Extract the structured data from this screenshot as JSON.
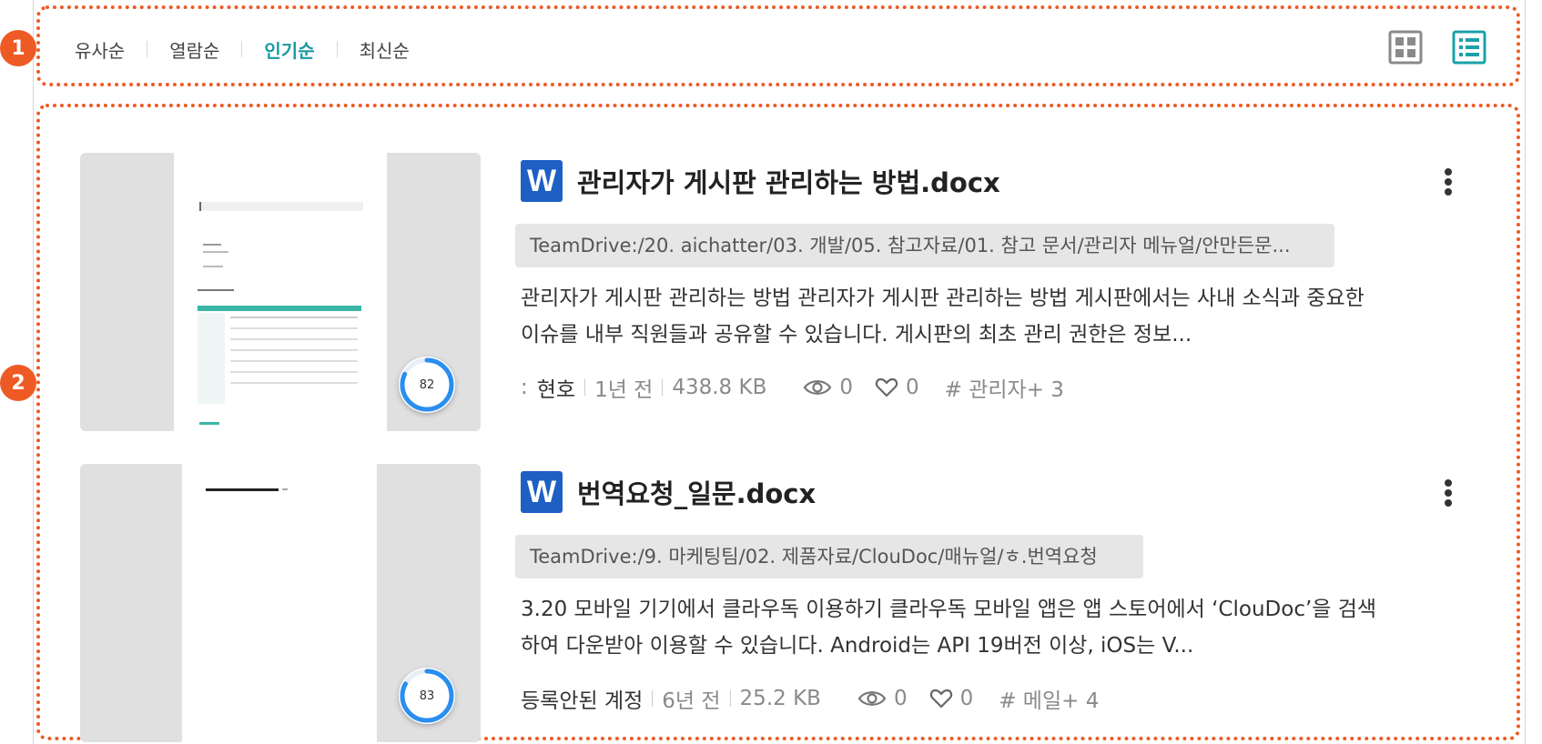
{
  "callouts": [
    "1",
    "2"
  ],
  "sort": {
    "options": [
      "유사순",
      "열람순",
      "인기순",
      "최신순"
    ],
    "active": "인기순"
  },
  "view_toggle": {
    "grid_icon": "grid-view-icon",
    "list_icon": "list-view-icon",
    "active": "list"
  },
  "colors": {
    "accent": "#1a9aa3",
    "callout": "#ee5a24",
    "word": "#1e5fc4",
    "score_ring": "#2a8ef0"
  },
  "results": [
    {
      "file_icon": "W",
      "title": "관리자가 게시판 관리하는 방법.docx",
      "path": "TeamDrive:/20. aichatter/03. 개발/05. 참고자료/01. 참고 문서/관리자 메뉴얼/안만든문...",
      "snippet": "관리자가 게시판 관리하는 방법 관리자가 게시판 관리하는 방법 게시판에서는 사내 소식과 중요한 이슈를 내부 직원들과 공유할 수 있습니다. 게시판의 최초 관리 권한은 정보...",
      "author": "현호",
      "author_prefix": ":",
      "age": "1년 전",
      "size": "438.8 KB",
      "views": "0",
      "likes": "0",
      "tag": "# 관리자+ 3",
      "score": "82",
      "score_fraction": 0.82
    },
    {
      "file_icon": "W",
      "title": "번역요청_일문.docx",
      "path": "TeamDrive:/9. 마케팅팀/02. 제품자료/ClouDoc/매뉴얼/ㅎ.번역요청",
      "snippet": "3.20 모바일 기기에서 클라우독 이용하기 클라우독 모바일 앱은 앱 스토어에서 ‘ClouDoc’을 검색하여 다운받아 이용할 수 있습니다. Android는 API 19버전 이상, iOS는 V...",
      "author": "등록안된 계정",
      "author_prefix": "",
      "age": "6년 전",
      "size": "25.2 KB",
      "views": "0",
      "likes": "0",
      "tag": "# 메일+ 4",
      "score": "83",
      "score_fraction": 0.83
    }
  ]
}
